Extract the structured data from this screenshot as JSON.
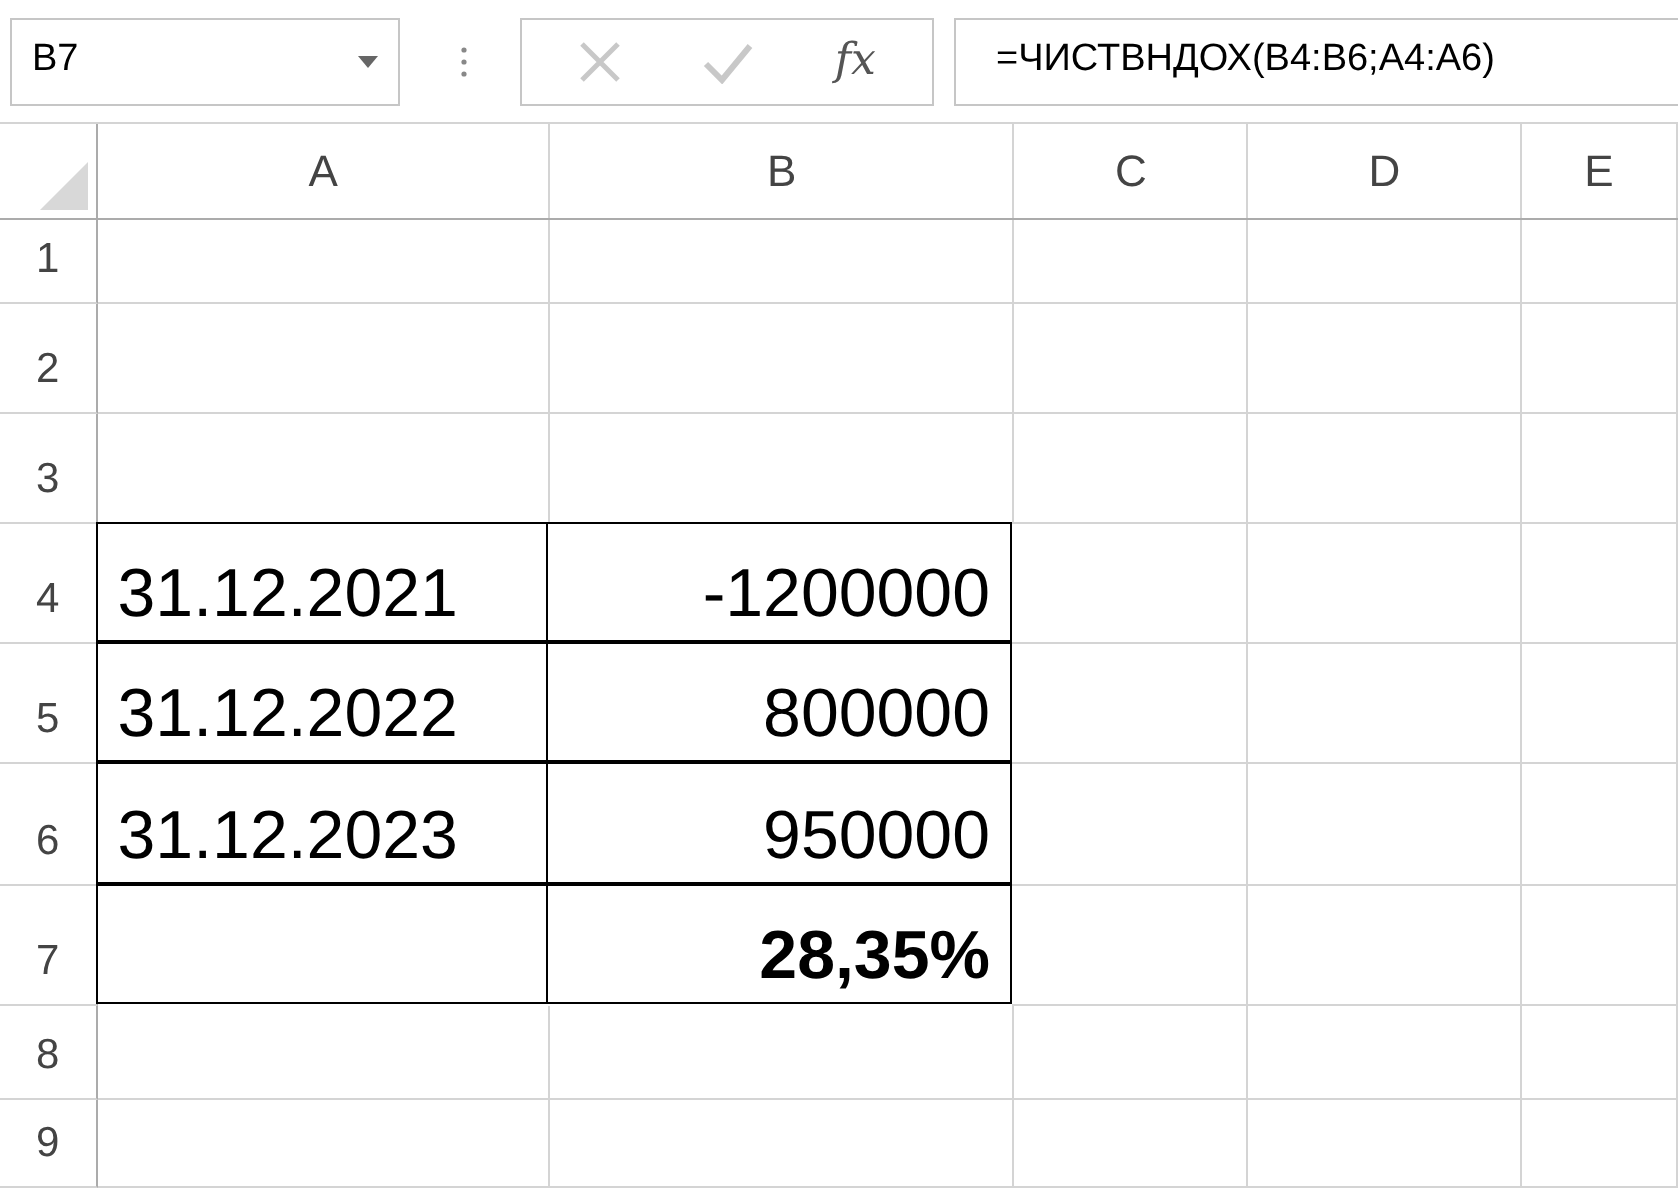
{
  "name_box": {
    "value": "B7"
  },
  "formula_bar": {
    "fx_label": "fx",
    "formula": "=ЧИСТВНДОХ(B4:B6;A4:A6)"
  },
  "columns": [
    {
      "label": "A"
    },
    {
      "label": "B"
    },
    {
      "label": "C"
    },
    {
      "label": "D"
    },
    {
      "label": "E"
    }
  ],
  "rows": [
    {
      "header": "1",
      "bordered": false,
      "cells": []
    },
    {
      "header": "2",
      "bordered": false,
      "cells": []
    },
    {
      "header": "3",
      "bordered": false,
      "cells": []
    },
    {
      "header": "4",
      "bordered": true,
      "cells": [
        {
          "text": "31.12.2021",
          "bold": false
        },
        {
          "text": "-1200000",
          "bold": false
        }
      ]
    },
    {
      "header": "5",
      "bordered": true,
      "cells": [
        {
          "text": "31.12.2022",
          "bold": false
        },
        {
          "text": "800000",
          "bold": false
        }
      ]
    },
    {
      "header": "6",
      "bordered": true,
      "cells": [
        {
          "text": "31.12.2023",
          "bold": false
        },
        {
          "text": "950000",
          "bold": false
        }
      ]
    },
    {
      "header": "7",
      "bordered": true,
      "cells": [
        {},
        {
          "text": "28,35%",
          "bold": true
        }
      ]
    },
    {
      "header": "8",
      "bordered": false,
      "cells": []
    },
    {
      "header": "9",
      "bordered": false,
      "cells": []
    }
  ]
}
